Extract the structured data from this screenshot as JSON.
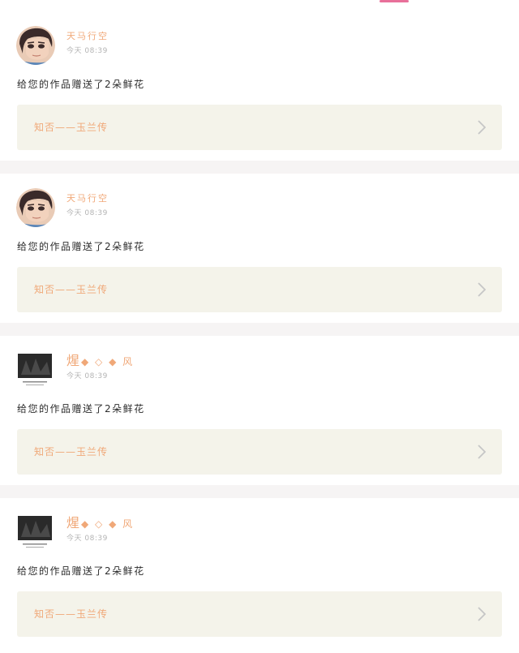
{
  "feed": {
    "items": [
      {
        "user": {
          "name": "天马行空",
          "time": "今天 08:39",
          "avatar": "anime-avatar"
        },
        "message": "给您的作品赠送了2朵鲜花",
        "work_title": "知否——玉兰传"
      },
      {
        "user": {
          "name": "天马行空",
          "time": "今天 08:39",
          "avatar": "anime-avatar"
        },
        "message": "给您的作品赠送了2朵鲜花",
        "work_title": "知否——玉兰传"
      },
      {
        "user": {
          "name_first": "煋",
          "name_rest": "◆ ◇ ◆ 风",
          "time": "今天 08:39",
          "avatar": "photo-avatar"
        },
        "message": "给您的作品赠送了2朵鲜花",
        "work_title": "知否——玉兰传"
      },
      {
        "user": {
          "name_first": "煋",
          "name_rest": "◆ ◇ ◆ 风",
          "time": "今天 08:39",
          "avatar": "photo-avatar"
        },
        "message": "给您的作品赠送了2朵鲜花",
        "work_title": "知否——玉兰传"
      }
    ]
  },
  "colors": {
    "accent": "#e8709a",
    "username": "#f0a878",
    "card_bg": "#f4f3ea",
    "separator": "#f6f4f4"
  },
  "icons": {
    "chevron": "chevron-right-icon"
  }
}
